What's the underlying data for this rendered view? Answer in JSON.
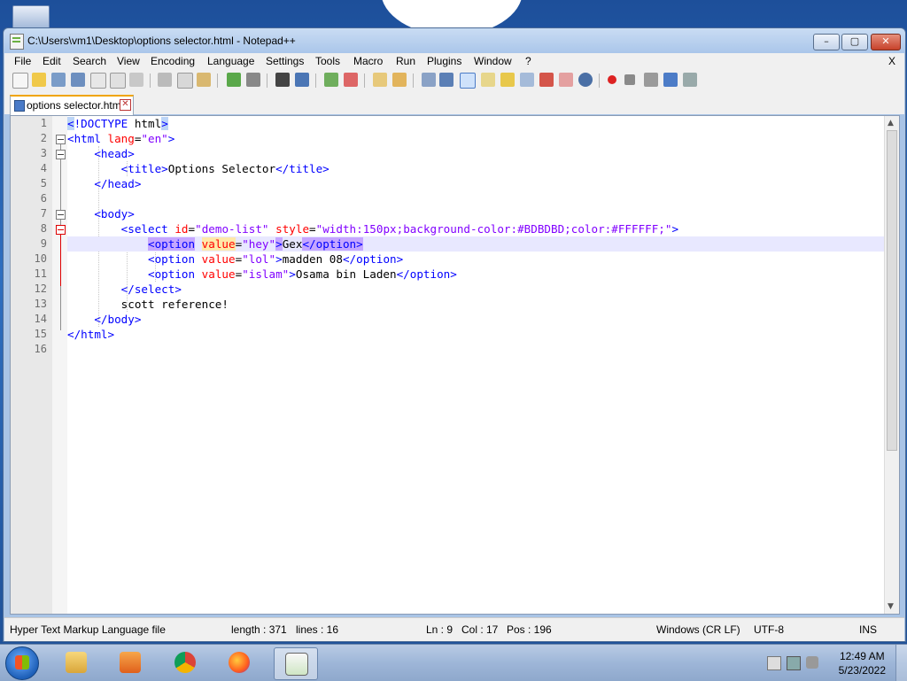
{
  "window": {
    "title": "C:\\Users\\vm1\\Desktop\\options selector.html - Notepad++",
    "minimize": "–",
    "maximize": "▢",
    "close": "✕"
  },
  "menu": {
    "items": [
      "File",
      "Edit",
      "Search",
      "View",
      "Encoding",
      "Language",
      "Settings",
      "Tools",
      "Macro",
      "Run",
      "Plugins",
      "Window",
      "?"
    ],
    "close_doc": "X"
  },
  "tab": {
    "label": "options selector.html",
    "close": "✕"
  },
  "editor": {
    "line_numbers": [
      "1",
      "2",
      "3",
      "4",
      "5",
      "6",
      "7",
      "8",
      "9",
      "10",
      "11",
      "12",
      "13",
      "14",
      "15",
      "16"
    ],
    "current_line": 9
  },
  "status": {
    "file_type": "Hyper Text Markup Language file",
    "length": "length : 371",
    "lines": "lines : 16",
    "ln": "Ln : 9",
    "col": "Col : 17",
    "pos": "Pos : 196",
    "eol": "Windows (CR LF)",
    "encoding": "UTF-8",
    "mode": "INS"
  },
  "taskbar": {
    "time": "12:49 AM",
    "date": "5/23/2022"
  },
  "colors": {
    "tag": "#0000ff",
    "attribute": "#ff0000",
    "value": "#8000ff",
    "highlight": "#c5a6ff",
    "current_line": "#e8e8ff"
  }
}
